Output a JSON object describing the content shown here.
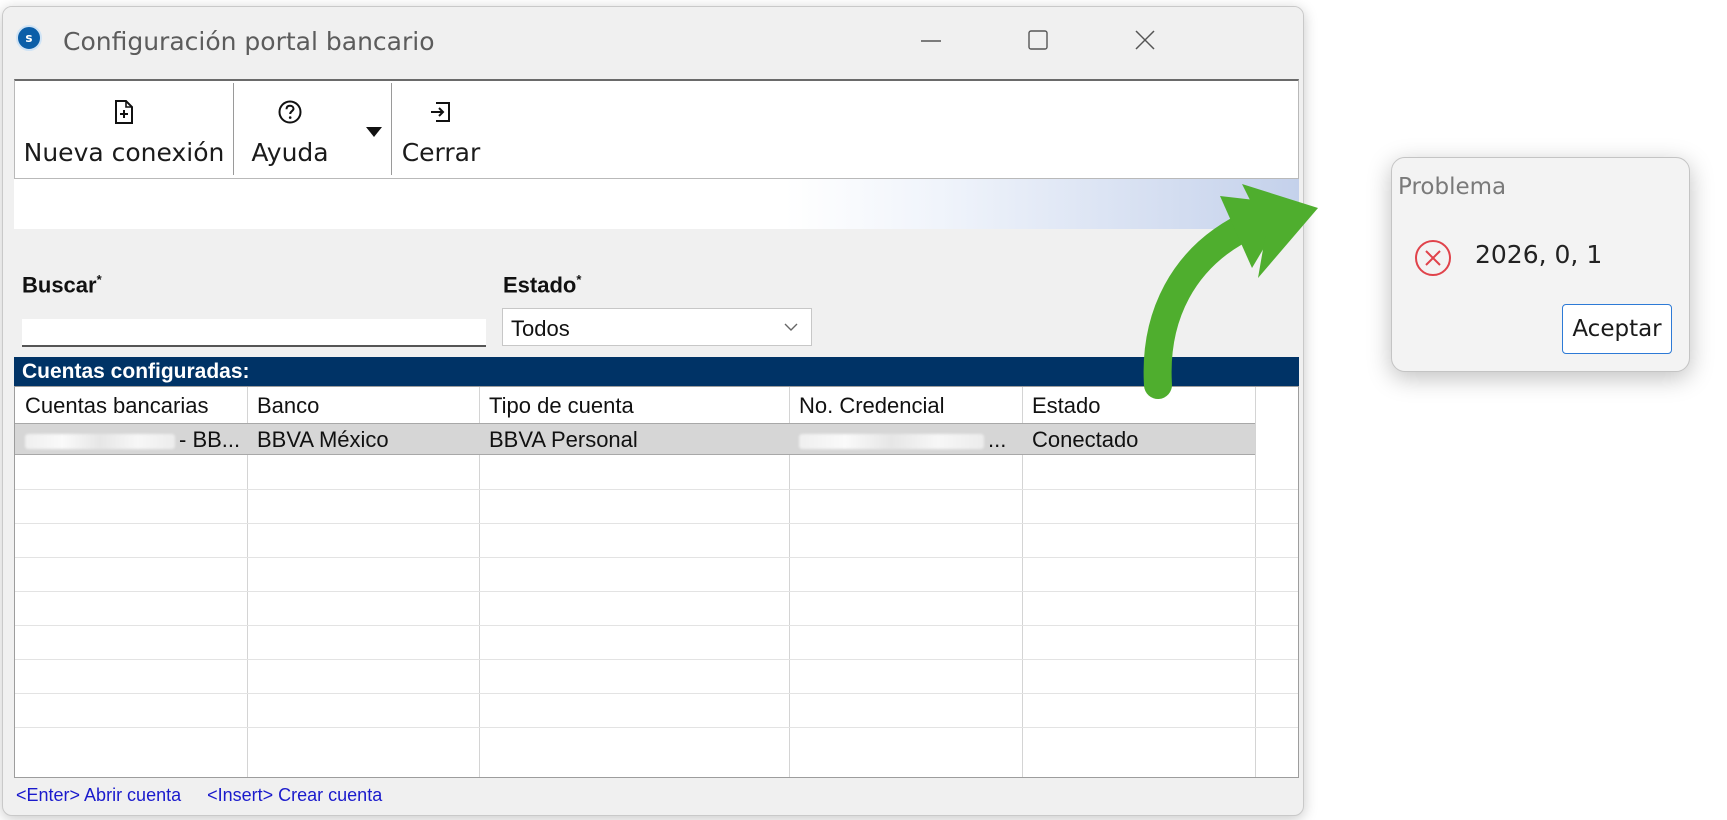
{
  "window": {
    "title": "Configuración portal bancario",
    "app_icon_letter": "s"
  },
  "toolbar": {
    "new_connection": {
      "label": "Nueva conexión",
      "icon": "file-plus-icon"
    },
    "help": {
      "label": "Ayuda",
      "icon": "help-circle-icon"
    },
    "close": {
      "label": "Cerrar",
      "icon": "sign-out-icon"
    }
  },
  "filters": {
    "search_label": "Buscar",
    "search_required": "*",
    "search_value": "",
    "status_label": "Estado",
    "status_required": "*",
    "status_value": "Todos"
  },
  "accounts": {
    "section_title": "Cuentas configuradas:",
    "columns": [
      "Cuentas bancarias",
      "Banco",
      "Tipo de cuenta",
      "No. Credencial",
      "Estado"
    ],
    "rows": [
      {
        "account_suffix": "- BB...",
        "bank": "BBVA México",
        "account_type": "BBVA Personal",
        "credential_suffix": "...",
        "status": "Conectado"
      }
    ]
  },
  "status_bar": {
    "hint_open": "<Enter> Abrir cuenta",
    "hint_create": "<Insert> Crear cuenta"
  },
  "dialog": {
    "title": "Problema",
    "message": "2026, 0, 1",
    "ok_label": "Aceptar"
  },
  "colors": {
    "section_bar": "#003366",
    "status_link": "#1a1acc",
    "arrow": "#4fae2e",
    "error_icon": "#e0434b",
    "dialog_button_border": "#2d7ad6"
  }
}
